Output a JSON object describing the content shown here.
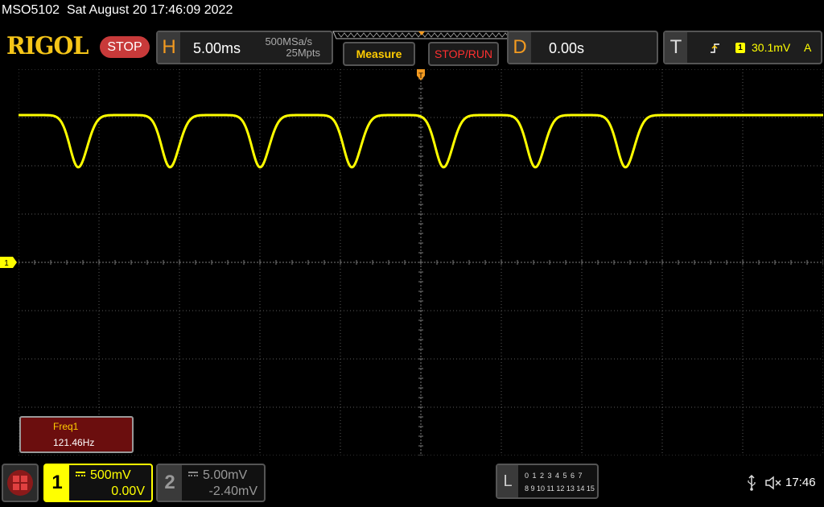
{
  "status": {
    "model": "MSO5102",
    "datetime": "Sat August 20 17:46:09 2022"
  },
  "brand": "RIGOL",
  "run_state": "STOP",
  "horizontal": {
    "letter": "H",
    "timebase": "5.00ms",
    "sample_rate": "500MSa/s",
    "memory_depth": "25Mpts"
  },
  "buttons": {
    "measure": "Measure",
    "stop_run": "STOP/RUN"
  },
  "delay": {
    "letter": "D",
    "value": "0.00s"
  },
  "trigger": {
    "letter": "T",
    "source": "1",
    "level": "30.1mV",
    "mode": "A"
  },
  "channel_marker": "1",
  "measurement": {
    "label": "Freq1",
    "value": "121.46Hz"
  },
  "ch1": {
    "number": "1",
    "scale": "500mV",
    "offset": "0.00V"
  },
  "ch2": {
    "number": "2",
    "scale": "5.00mV",
    "offset": "-2.40mV"
  },
  "logic": {
    "letter": "L",
    "row1": "0 1 2 3  4 5 6 7",
    "row2": "8 9 10 11 12 13 14 15"
  },
  "clock": "17:46",
  "colors": {
    "ch1": "#ffff00",
    "trigger": "#f39a20",
    "grid": "#5a5a5a",
    "stop": "#c83a3a"
  },
  "icons": [
    "menu-icon",
    "usb-icon",
    "speaker-muted-icon",
    "trigger-edge-icon",
    "trigger-position-icon"
  ],
  "waveform": {
    "dips_at_time_ms": [
      -21.2,
      -15.5,
      -9.9,
      -4.2,
      1.5,
      7.2,
      12.8
    ],
    "frequency_hz": 121.46
  }
}
